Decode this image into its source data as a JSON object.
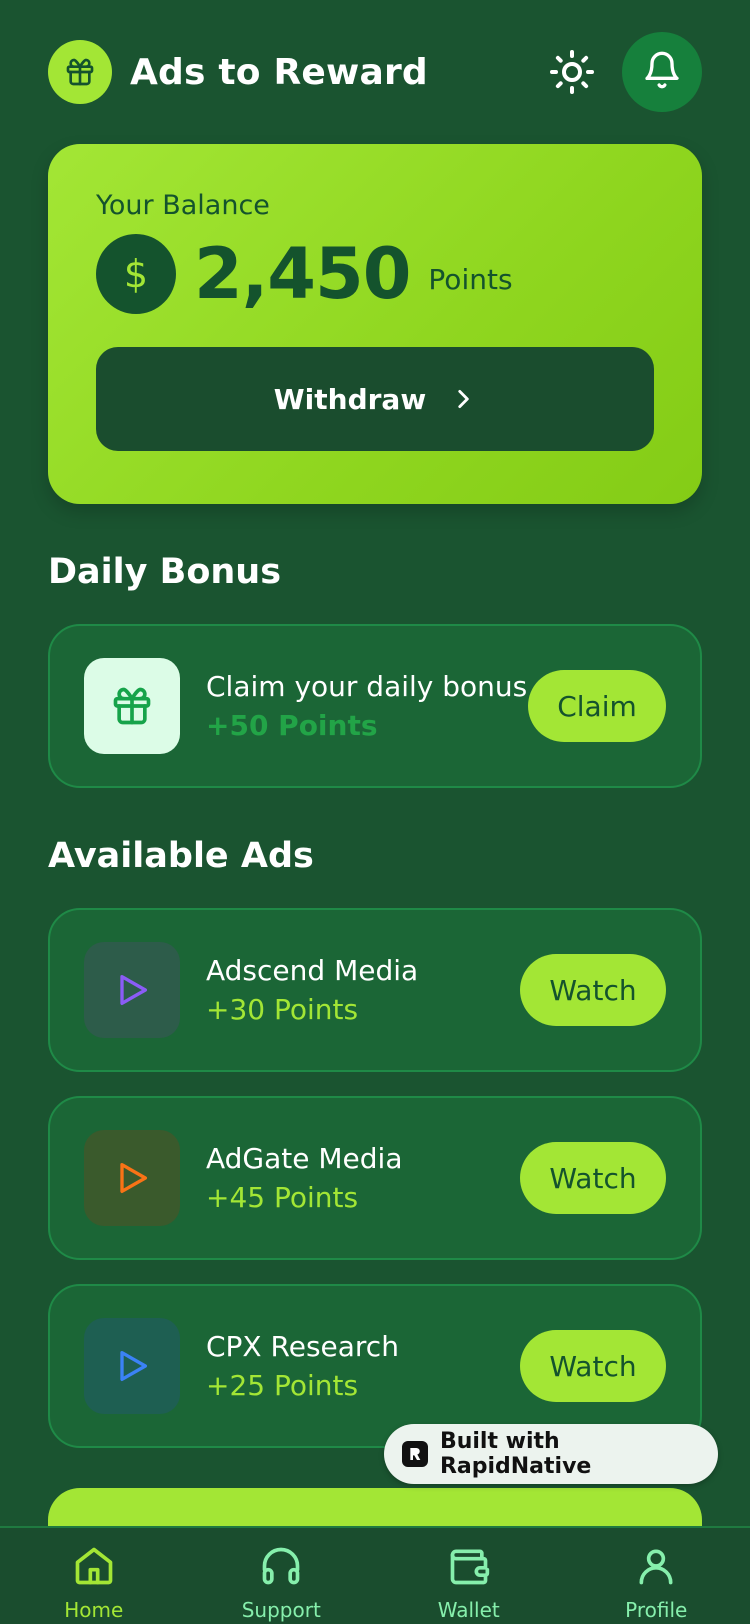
{
  "header": {
    "title": "Ads to Reward",
    "logo_icon": "gift-icon",
    "theme_icon": "sun-icon",
    "bell_icon": "bell-icon"
  },
  "balance": {
    "label": "Your Balance",
    "currency_symbol": "$",
    "value": "2,450",
    "unit": "Points",
    "withdraw_label": "Withdraw"
  },
  "daily_bonus": {
    "section_title": "Daily Bonus",
    "title": "Claim your daily bonus",
    "points": "+50 Points",
    "button_label": "Claim"
  },
  "ads": {
    "section_title": "Available Ads",
    "items": [
      {
        "name": "Adscend Media",
        "points": "+30 Points",
        "button_label": "Watch",
        "icon_color": "#8b5cf6"
      },
      {
        "name": "AdGate Media",
        "points": "+45 Points",
        "button_label": "Watch",
        "icon_color": "#f97316"
      },
      {
        "name": "CPX Research",
        "points": "+25 Points",
        "button_label": "Watch",
        "icon_color": "#3b82f6"
      }
    ]
  },
  "badge": {
    "label": "Built with RapidNative"
  },
  "tabs": [
    {
      "label": "Home",
      "icon": "home-icon",
      "active": true
    },
    {
      "label": "Support",
      "icon": "headphones-icon",
      "active": false
    },
    {
      "label": "Wallet",
      "icon": "wallet-icon",
      "active": false
    },
    {
      "label": "Profile",
      "icon": "user-icon",
      "active": false
    }
  ],
  "colors": {
    "background": "#1a5430",
    "accent": "#a3e635",
    "card": "#1b6636",
    "active_tab": "#a3e635",
    "inactive_tab": "#86efac"
  }
}
